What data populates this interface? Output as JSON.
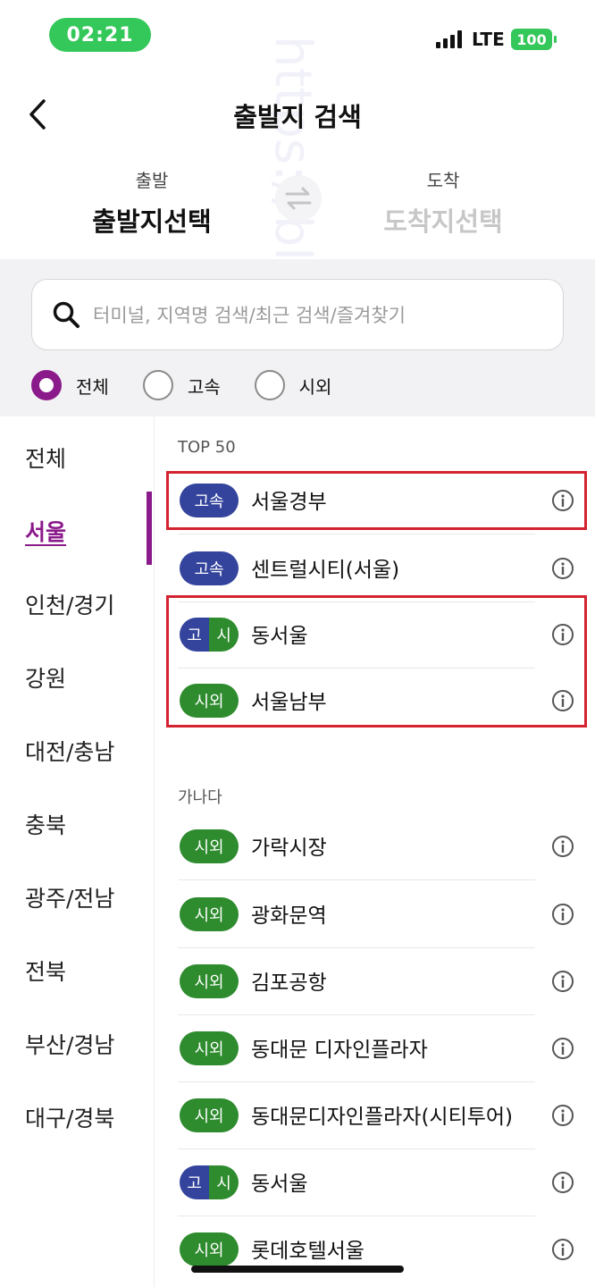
{
  "status": {
    "time": "02:21",
    "network": "LTE",
    "battery": "100"
  },
  "header": {
    "title": "출발지 검색"
  },
  "route": {
    "departure_label": "출발",
    "departure_value": "출발지선택",
    "arrival_label": "도착",
    "arrival_value": "도착지선택"
  },
  "search": {
    "placeholder": "터미널, 지역명 검색/최근 검색/즐겨찾기"
  },
  "filters": [
    {
      "label": "전체",
      "selected": true
    },
    {
      "label": "고속",
      "selected": false
    },
    {
      "label": "시외",
      "selected": false
    }
  ],
  "regions": [
    {
      "label": "전체",
      "active": false
    },
    {
      "label": "서울",
      "active": true
    },
    {
      "label": "인천/경기",
      "active": false
    },
    {
      "label": "강원",
      "active": false
    },
    {
      "label": "대전/충남",
      "active": false
    },
    {
      "label": "충북",
      "active": false
    },
    {
      "label": "광주/전남",
      "active": false
    },
    {
      "label": "전북",
      "active": false
    },
    {
      "label": "부산/경남",
      "active": false
    },
    {
      "label": "대구/경북",
      "active": false
    }
  ],
  "top50": {
    "label": "TOP 50",
    "items": [
      {
        "type": "express",
        "badge": "고속",
        "name": "서울경부"
      },
      {
        "type": "express",
        "badge": "고속",
        "name": "센트럴시티(서울)"
      },
      {
        "type": "both",
        "badge_a": "고",
        "badge_b": "시",
        "name": "동서울"
      },
      {
        "type": "intercity",
        "badge": "시외",
        "name": "서울남부"
      }
    ]
  },
  "alphabetical": {
    "label": "가나다",
    "items": [
      {
        "type": "intercity",
        "badge": "시외",
        "name": "가락시장"
      },
      {
        "type": "intercity",
        "badge": "시외",
        "name": "광화문역"
      },
      {
        "type": "intercity",
        "badge": "시외",
        "name": "김포공항"
      },
      {
        "type": "intercity",
        "badge": "시외",
        "name": "동대문 디자인플라자"
      },
      {
        "type": "intercity",
        "badge": "시외",
        "name": "동대문디자인플라자(시티투어)"
      },
      {
        "type": "both",
        "badge_a": "고",
        "badge_b": "시",
        "name": "동서울"
      },
      {
        "type": "intercity",
        "badge": "시외",
        "name": "롯데호텔서울"
      }
    ]
  },
  "watermark": "https://blog.naver.com/nnatirk_",
  "colors": {
    "accent": "#8b1a8b",
    "express": "#34449c",
    "intercity": "#2e8b2e",
    "status_green": "#34c759",
    "highlight": "#d42330"
  }
}
